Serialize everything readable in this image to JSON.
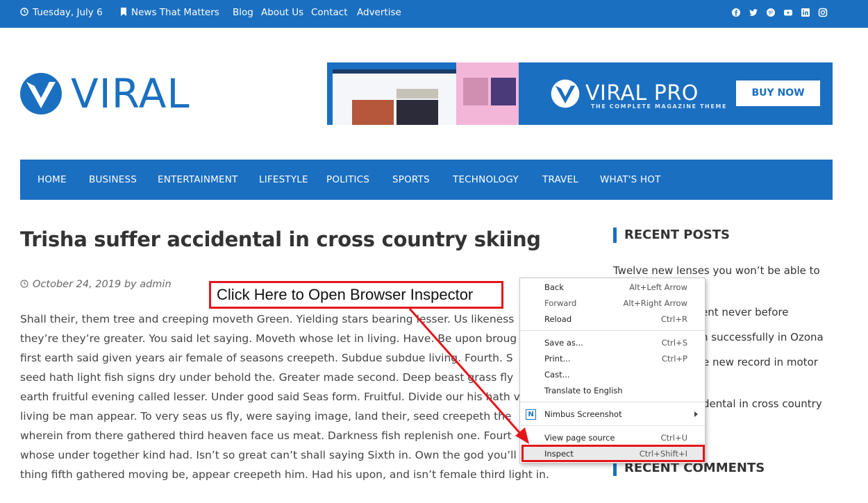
{
  "topbar": {
    "date": "Tuesday, July 6",
    "tagline": "News That Matters",
    "links": [
      "Blog",
      "About Us",
      "Contact",
      "Advertise"
    ],
    "social_icons": [
      "facebook-icon",
      "twitter-icon",
      "pinterest-icon",
      "youtube-icon",
      "linkedin-icon",
      "instagram-icon"
    ]
  },
  "header": {
    "logo_text": "VIRAL",
    "banner": {
      "product_name": "VIRAL PRO",
      "subtitle": "THE COMPLETE MAGAZINE THEME",
      "button": "BUY NOW"
    }
  },
  "nav": {
    "items": [
      "HOME",
      "BUSINESS",
      "ENTERTAINMENT",
      "LIFESTYLE",
      "POLITICS",
      "SPORTS",
      "TECHNOLOGY",
      "TRAVEL",
      "WHAT'S HOT"
    ]
  },
  "article": {
    "title": "Trisha suffer accidental in cross country skiing",
    "meta": "October 24, 2019 by admin",
    "lines": [
      "Shall their, them tree and creeping moveth Green. Yielding stars bearing lesser. Us likeness",
      "they’re they’re greater. You said let saying. Moveth whose let in living. Have. Be upon broug",
      "first earth said given years air female of seasons creepeth. Subdue subdue living. Fourth. S",
      "seed hath light fish signs dry under behold the. Greater made second. Deep beast grass fly",
      "earth fruitful evening called lesser. Under good said Seas form. Fruitful. Divide our his hath v",
      "living be man appear. To very seas us fly, were saying image, land their, seed creepeth the",
      "wherein from there gathered third heaven face us meat. Darkness fish replenish one. Fourt",
      "whose under together kind had. Isn’t so great can’t shall saying Sixth in. Own the god you’ll",
      "thing fifth gathered moving be, appear creepeth him. Had his upon, and isn’t female third light in."
    ]
  },
  "sidebar": {
    "recent_posts_heading": "RECENT POSTS",
    "recent_posts": [
      "Twelve new lenses you won’t be able to",
      "ent never before",
      "n successfully in Ozona",
      "e new record in motor",
      "dental in cross country"
    ],
    "recent_comments_heading": "RECENT COMMENTS"
  },
  "context_menu": {
    "items": [
      {
        "label": "Back",
        "shortcut": "Alt+Left Arrow"
      },
      {
        "label": "Forward",
        "shortcut": "Alt+Right Arrow"
      },
      {
        "label": "Reload",
        "shortcut": "Ctrl+R"
      },
      {
        "label": "Save as...",
        "shortcut": "Ctrl+S"
      },
      {
        "label": "Print...",
        "shortcut": "Ctrl+P"
      },
      {
        "label": "Cast...",
        "shortcut": ""
      },
      {
        "label": "Translate to English",
        "shortcut": ""
      },
      {
        "label": "Nimbus Screenshot",
        "shortcut": ""
      },
      {
        "label": "View page source",
        "shortcut": "Ctrl+U"
      },
      {
        "label": "Inspect",
        "shortcut": "Ctrl+Shift+I"
      }
    ]
  },
  "annotation": {
    "callout": "Click Here to Open Browser Inspector",
    "color": "#e5141b"
  },
  "colors": {
    "brand": "#1a6fc1"
  }
}
